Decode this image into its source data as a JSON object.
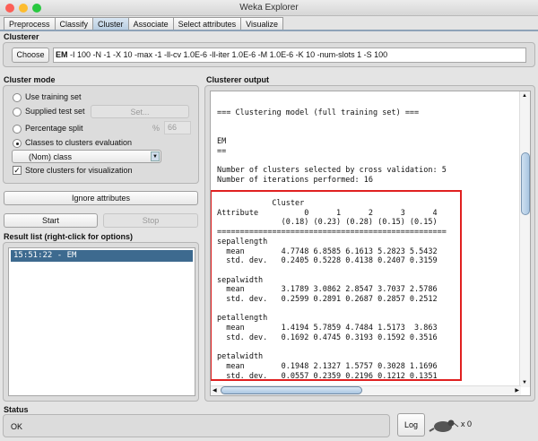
{
  "window": {
    "title": "Weka Explorer"
  },
  "tabs": [
    "Preprocess",
    "Classify",
    "Cluster",
    "Associate",
    "Select attributes",
    "Visualize"
  ],
  "active_tab": "Cluster",
  "clusterer": {
    "label": "Clusterer",
    "choose_label": "Choose",
    "name": "EM",
    "options": "-I 100 -N -1 -X 10 -max -1 -ll-cv 1.0E-6 -ll-iter 1.0E-6 -M 1.0E-6 -K 10 -num-slots 1 -S 100"
  },
  "cluster_mode": {
    "label": "Cluster mode",
    "use_training": "Use training set",
    "supplied_test": "Supplied test set",
    "set_label": "Set...",
    "percentage_split": "Percentage split",
    "percent_symbol": "%",
    "percent_value": "66",
    "classes_to_clusters": "Classes to clusters evaluation",
    "selected_mode": "classes_to_clusters",
    "class_select": "(Nom) class",
    "store_clusters": "Store clusters for visualization",
    "store_clusters_checked": true
  },
  "ignore_attributes_label": "Ignore attributes",
  "start_label": "Start",
  "stop_label": "Stop",
  "result_list": {
    "label": "Result list (right-click for options)",
    "items": [
      "15:51:22 - EM"
    ]
  },
  "output": {
    "label": "Clusterer output",
    "lines": [
      "=== Clustering model (full training set) ===",
      "",
      "",
      "EM",
      "==",
      "",
      "Number of clusters selected by cross validation: 5",
      "Number of iterations performed: 16"
    ],
    "table": {
      "cluster_header": "Cluster",
      "attribute_header": "Attribute",
      "clusters": [
        "0",
        "1",
        "2",
        "3",
        "4"
      ],
      "priors": [
        "(0.18)",
        "(0.23)",
        "(0.28)",
        "(0.15)",
        "(0.15)"
      ],
      "mean_label": "mean",
      "std_label": "std. dev.",
      "attributes": [
        {
          "name": "sepallength",
          "mean": [
            "4.7748",
            "6.8585",
            "6.1613",
            "5.2823",
            "5.5432"
          ],
          "std": [
            "0.2405",
            "0.5228",
            "0.4138",
            "0.2407",
            "0.3159"
          ]
        },
        {
          "name": "sepalwidth",
          "mean": [
            "3.1789",
            "3.0862",
            "2.8547",
            "3.7037",
            "2.5786"
          ],
          "std": [
            "0.2599",
            "0.2891",
            "0.2687",
            "0.2857",
            "0.2512"
          ]
        },
        {
          "name": "petallength",
          "mean": [
            "1.4194",
            "5.7859",
            "4.7484",
            "1.5173",
            "3.863"
          ],
          "std": [
            "0.1692",
            "0.4745",
            "0.3193",
            "0.1592",
            "0.3516"
          ]
        },
        {
          "name": "petalwidth",
          "mean": [
            "0.1948",
            "2.1327",
            "1.5757",
            "0.3028",
            "1.1696"
          ],
          "std": [
            "0.0557",
            "0.2359",
            "0.2196",
            "0.1212",
            "0.1351"
          ]
        }
      ]
    },
    "highlight_color": "#e02020"
  },
  "status": {
    "label": "Status",
    "text": "OK",
    "log_label": "Log",
    "bird_icon": "weka-bird-icon",
    "count": "x 0"
  }
}
